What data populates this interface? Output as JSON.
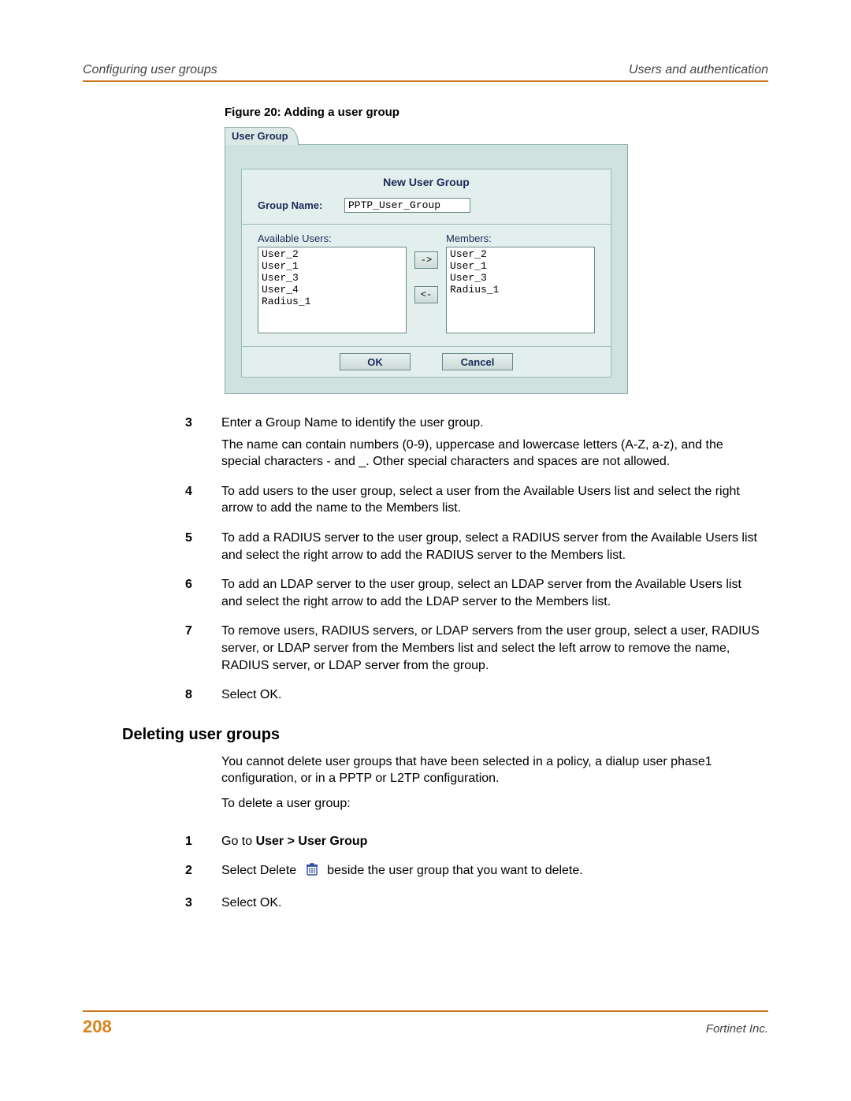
{
  "header": {
    "left": "Configuring user groups",
    "right": "Users and authentication"
  },
  "figure": {
    "caption": "Figure 20: Adding a user group",
    "tab": "User Group",
    "panel_title": "New User Group",
    "group_name_label": "Group Name:",
    "group_name_value": "PPTP_User_Group",
    "available_label": "Available Users:",
    "members_label": "Members:",
    "available_users": [
      "User_2",
      "User_1",
      "User_3",
      "User_4",
      "Radius_1"
    ],
    "members": [
      "User_2",
      "User_1",
      "User_3",
      "Radius_1"
    ],
    "add_label": "->",
    "remove_label": "<-",
    "ok_label": "OK",
    "cancel_label": "Cancel"
  },
  "steps_a": [
    {
      "num": "3",
      "paras": [
        "Enter a Group Name to identify the user group.",
        "The name can contain numbers (0-9), uppercase and lowercase letters (A-Z, a-z), and the special characters - and _. Other special characters and spaces are not allowed."
      ]
    },
    {
      "num": "4",
      "paras": [
        "To add users to the user group, select a user from the Available Users list and select the right arrow to add the name to the Members list."
      ]
    },
    {
      "num": "5",
      "paras": [
        "To add a RADIUS server to the user group, select a RADIUS server from the Available Users list and select the right arrow to add the RADIUS server to the Members list."
      ]
    },
    {
      "num": "6",
      "paras": [
        "To add an LDAP server to the user group, select an LDAP server from the Available Users list and select the right arrow to add the LDAP server to the Members list."
      ]
    },
    {
      "num": "7",
      "paras": [
        "To remove users, RADIUS servers, or LDAP servers from the user group, select a user, RADIUS server, or LDAP server from the Members list and select the left arrow to remove the name, RADIUS server, or LDAP server from the group."
      ]
    },
    {
      "num": "8",
      "paras": [
        "Select OK."
      ]
    }
  ],
  "section2": {
    "heading": "Deleting user groups",
    "intro": "You cannot delete user groups that have been selected in a policy, a dialup user phase1 configuration, or in a PPTP or L2TP configuration.",
    "lead": "To delete a user group:"
  },
  "steps_b": {
    "s1": {
      "num": "1",
      "prefix": "Go to ",
      "bold": "User > User Group"
    },
    "s2": {
      "num": "2",
      "before": "Select Delete",
      "after": "beside the user group that you want to delete."
    },
    "s3": {
      "num": "3",
      "text": "Select OK."
    }
  },
  "footer": {
    "page": "208",
    "brand": "Fortinet Inc."
  }
}
